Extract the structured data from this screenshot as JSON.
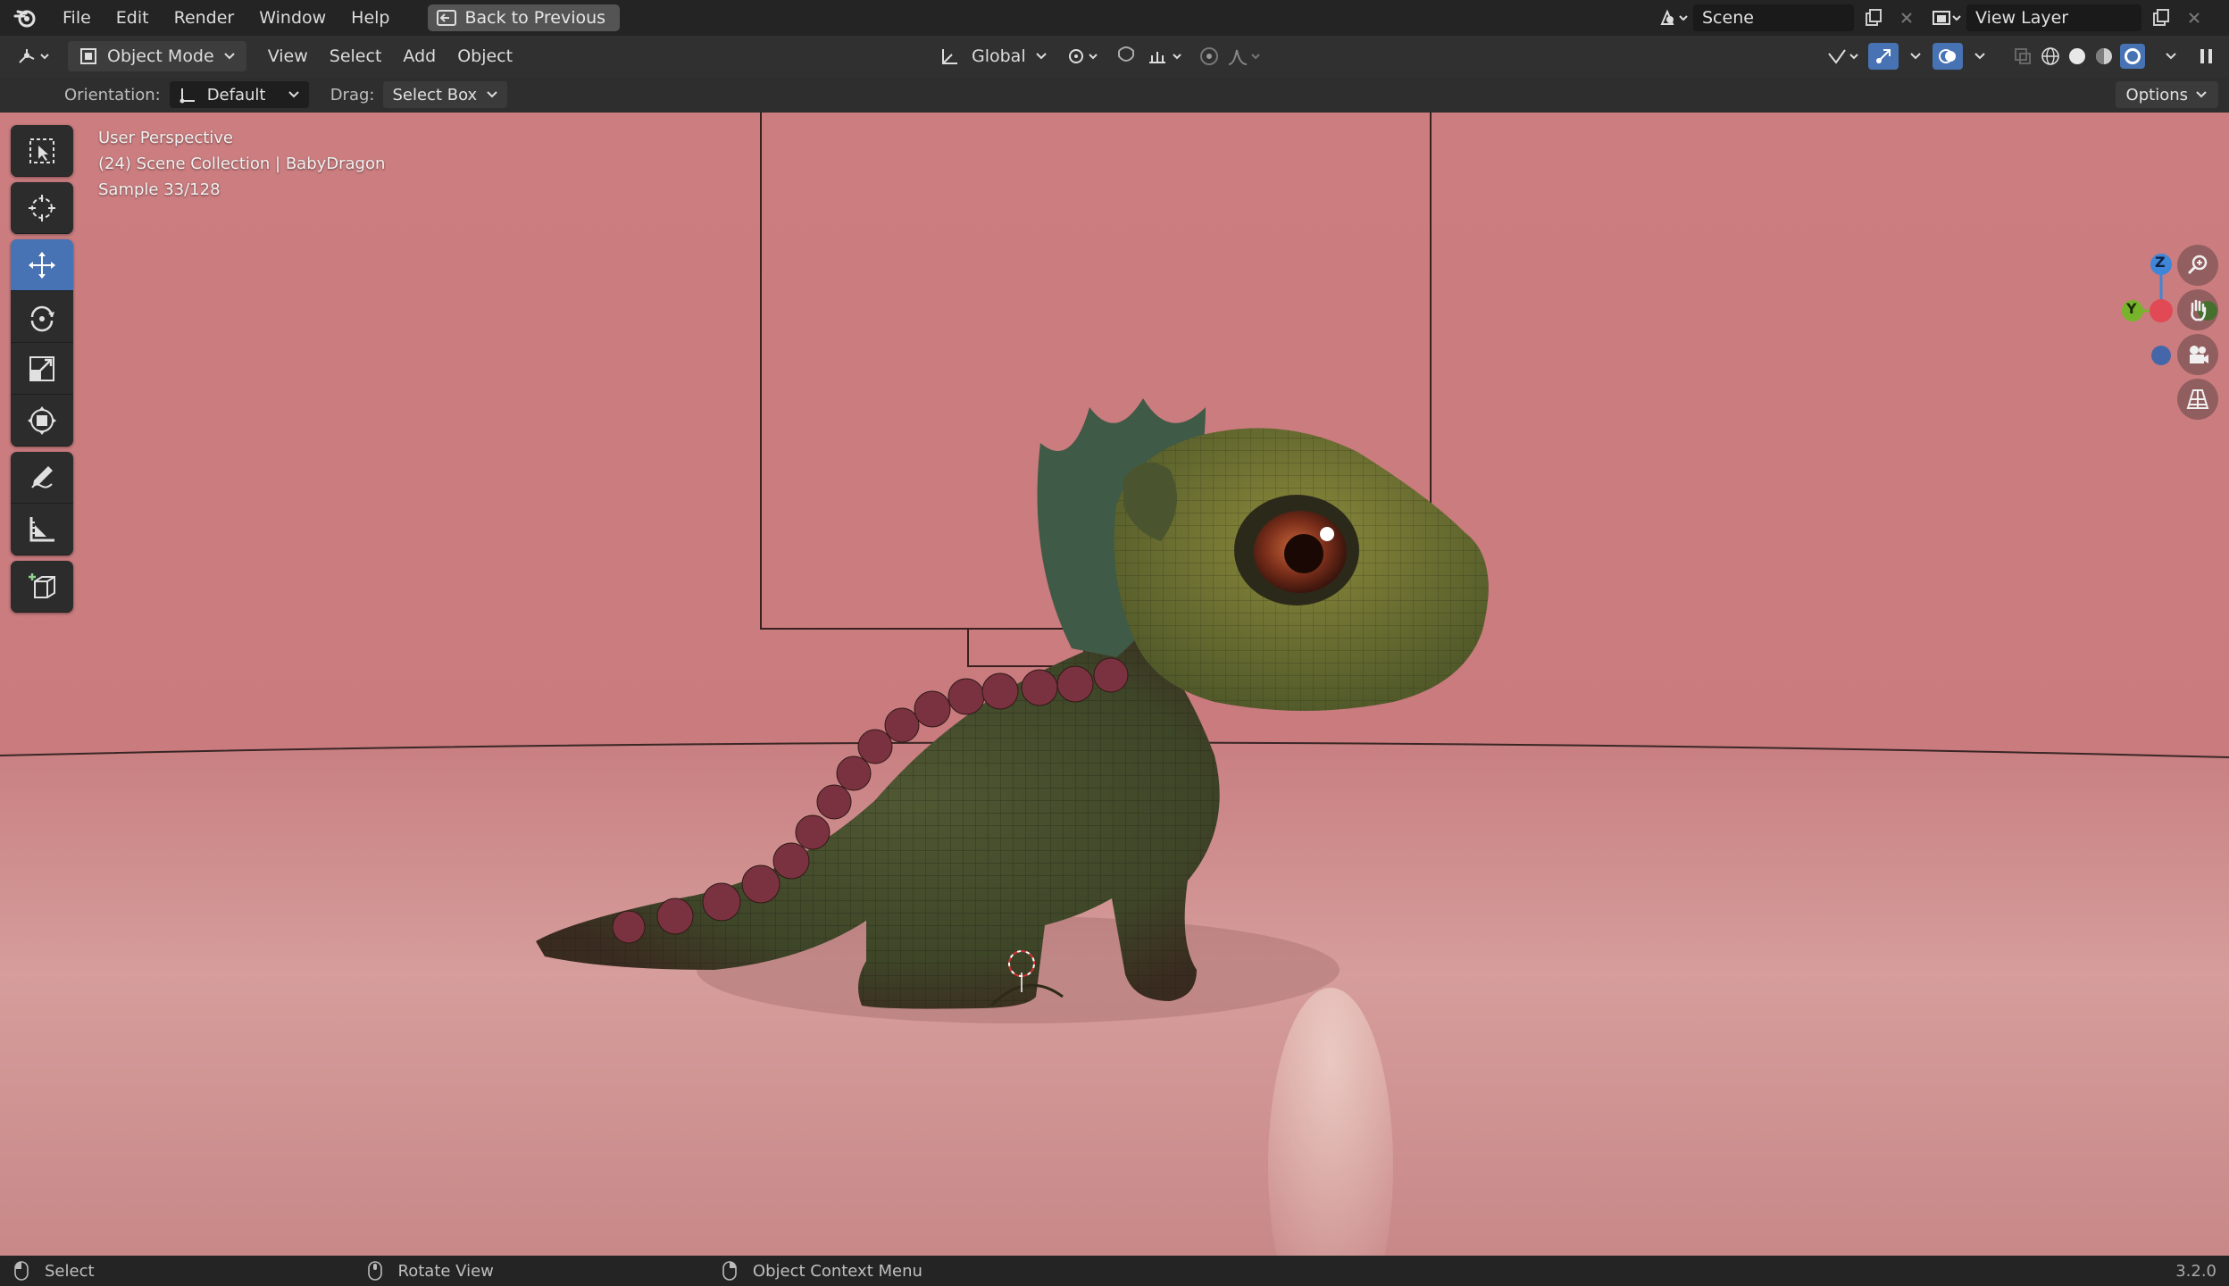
{
  "topbar": {
    "menus": [
      "File",
      "Edit",
      "Render",
      "Window",
      "Help"
    ],
    "back_button": "Back to Previous",
    "scene_name": "Scene",
    "view_layer_name": "View Layer"
  },
  "header": {
    "mode": "Object Mode",
    "menus": [
      "View",
      "Select",
      "Add",
      "Object"
    ],
    "transform_orientation": "Global"
  },
  "tool_settings": {
    "orientation_label": "Orientation:",
    "orientation_value": "Default",
    "drag_label": "Drag:",
    "drag_value": "Select Box",
    "options_label": "Options"
  },
  "viewport": {
    "overlay_lines": [
      "User Perspective",
      "(24) Scene Collection | BabyDragon",
      "Sample 33/128"
    ],
    "gizmo": {
      "z_label": "Z",
      "y_label": "Y"
    }
  },
  "toolbar_tools": [
    "select-box",
    "cursor",
    "move",
    "rotate",
    "scale",
    "transform",
    "annotate",
    "measure",
    "add-cube"
  ],
  "statusbar": {
    "items": [
      "Select",
      "Rotate View",
      "Object Context Menu"
    ],
    "version": "3.2.0"
  },
  "colors": {
    "accent": "#4772b3",
    "viewport_bg": "#cb7d7f",
    "x_axis": "#e14a55",
    "y_axis": "#78b42b",
    "z_axis": "#3f86d8"
  }
}
